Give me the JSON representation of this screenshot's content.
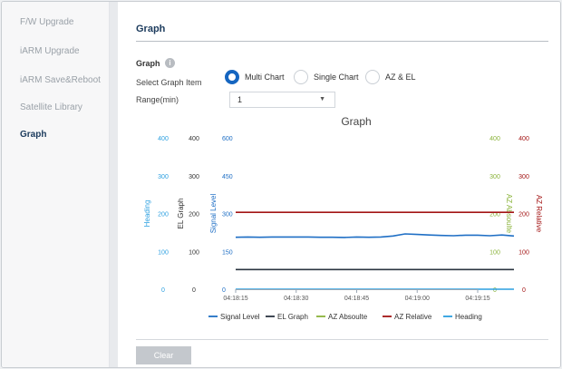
{
  "sidebar": {
    "items": [
      {
        "label": "F/W Upgrade",
        "active": false
      },
      {
        "label": "iARM Upgrade",
        "active": false
      },
      {
        "label": "iARM Save&Reboot",
        "active": false
      },
      {
        "label": "Satellite Library",
        "active": false
      },
      {
        "label": "Graph",
        "active": true
      }
    ]
  },
  "page": {
    "title": "Graph",
    "section_label": "Graph",
    "info_icon": "i",
    "select_item_label": "Select Graph Item",
    "range_label": "Range(min)",
    "graph_items": [
      {
        "label": "Multi Chart",
        "checked": true
      },
      {
        "label": "Single Chart",
        "checked": false
      },
      {
        "label": "AZ & EL",
        "checked": false
      }
    ],
    "range_value": "1",
    "clear_label": "Clear"
  },
  "colors": {
    "signal": "#1f6fc5",
    "el": "#2b3440",
    "az_absolute": "#8ab33a",
    "az_relative": "#a31515",
    "heading": "#2b9fe0",
    "accent": "#1565c0"
  },
  "chart_data": {
    "type": "line",
    "title": "Graph",
    "x": [
      "04:18:15",
      "04:18:30",
      "04:18:45",
      "04:19:00",
      "04:19:15"
    ],
    "axes": {
      "heading": {
        "label": "Heading",
        "ylim": [
          0,
          400
        ],
        "ticks": [
          0,
          100,
          200,
          300,
          400
        ]
      },
      "el_graph": {
        "label": "EL Graph",
        "ylim": [
          0,
          400
        ],
        "ticks": [
          0,
          100,
          200,
          300,
          400
        ]
      },
      "signal_level": {
        "label": "Signal Level",
        "ylim": [
          0,
          600
        ],
        "ticks": [
          0,
          150,
          300,
          450,
          600
        ]
      },
      "az_absolute": {
        "label": "AZ Absoulte",
        "ylim": [
          0,
          400
        ],
        "ticks": [
          0,
          100,
          200,
          300,
          400
        ]
      },
      "az_relative": {
        "label": "AZ Relative",
        "ylim": [
          0,
          400
        ],
        "ticks": [
          0,
          100,
          200,
          300,
          400
        ]
      }
    },
    "series": [
      {
        "name": "Signal Level",
        "axis": "signal_level",
        "t": [
          0,
          3,
          6,
          9,
          12,
          15,
          18,
          21,
          24,
          27,
          30,
          33,
          36,
          39,
          42,
          45,
          48,
          51,
          54,
          57,
          60,
          63,
          66,
          69
        ],
        "values": [
          206,
          207,
          206,
          207,
          207,
          207,
          207,
          206,
          206,
          205,
          207,
          206,
          207,
          211,
          219,
          217,
          215,
          213,
          212,
          214,
          214,
          212,
          215,
          211
        ]
      },
      {
        "name": "EL Graph",
        "axis": "el_graph",
        "t": [
          0,
          69
        ],
        "values": [
          52,
          52
        ]
      },
      {
        "name": "AZ Absoulte",
        "axis": "az_absolute",
        "t": [],
        "values": []
      },
      {
        "name": "AZ Relative",
        "axis": "az_relative",
        "t": [
          0,
          69
        ],
        "values": [
          203,
          203
        ]
      },
      {
        "name": "Heading",
        "axis": "heading",
        "t": [
          0,
          69
        ],
        "values": [
          0,
          0
        ]
      }
    ],
    "legend": [
      "Signal Level",
      "EL Graph",
      "AZ Absoulte",
      "AZ Relative",
      "Heading"
    ],
    "legend_position": "bottom",
    "grid": false
  }
}
